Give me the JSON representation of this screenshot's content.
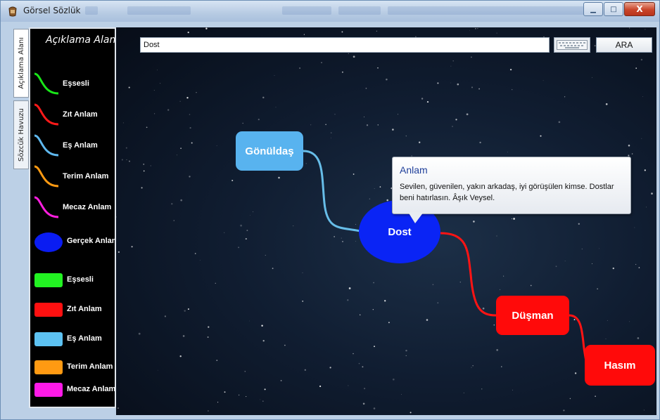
{
  "window": {
    "title": "Görsel Sözlük",
    "buttons": {
      "minimize": "▁",
      "maximize": "□",
      "close": "X"
    }
  },
  "vertical_tabs": [
    {
      "label": "Açıklama Alanı",
      "active": true
    },
    {
      "label": "Sözcük Havuzu",
      "active": false
    }
  ],
  "legend": {
    "title": "Açıklama Alanı",
    "line_items": [
      {
        "label": "Eşsesli",
        "color": "#19e619"
      },
      {
        "label": "Zıt Anlam",
        "color": "#ff1a1a"
      },
      {
        "label": "Eş Anlam",
        "color": "#5fb8ee"
      },
      {
        "label": "Terim Anlam",
        "color": "#ff9a12"
      },
      {
        "label": "Mecaz Anlam",
        "color": "#ff1fe0"
      }
    ],
    "real_meaning": {
      "label": "Gerçek Anlam",
      "color": "#0a1cf2"
    },
    "swatch_items": [
      {
        "label": "Eşsesli",
        "color": "#22f222"
      },
      {
        "label": "Zıt Anlam",
        "color": "#ff1010"
      },
      {
        "label": "Eş Anlam",
        "color": "#5dc2f2"
      },
      {
        "label": "Terim Anlam",
        "color": "#ff9a12"
      },
      {
        "label": "Mecaz Anlam",
        "color": "#ff1ae8"
      }
    ]
  },
  "search": {
    "value": "Dost",
    "keyboard_icon": "keyboard-icon",
    "button": "ARA"
  },
  "graph": {
    "nodes": {
      "gonuldas": "Gönüldaş",
      "dost": "Dost",
      "dusman": "Düşman",
      "hasim": "Hasım"
    },
    "link_colors": {
      "synonym": "#67bde8",
      "antonym": "#ff1414"
    }
  },
  "tooltip": {
    "title": "Anlam",
    "body": "Sevilen, güvenilen, yakın arkadaş, iyi görüşülen kimse. Dostlar beni hatırlasın. Âşık Veysel."
  }
}
